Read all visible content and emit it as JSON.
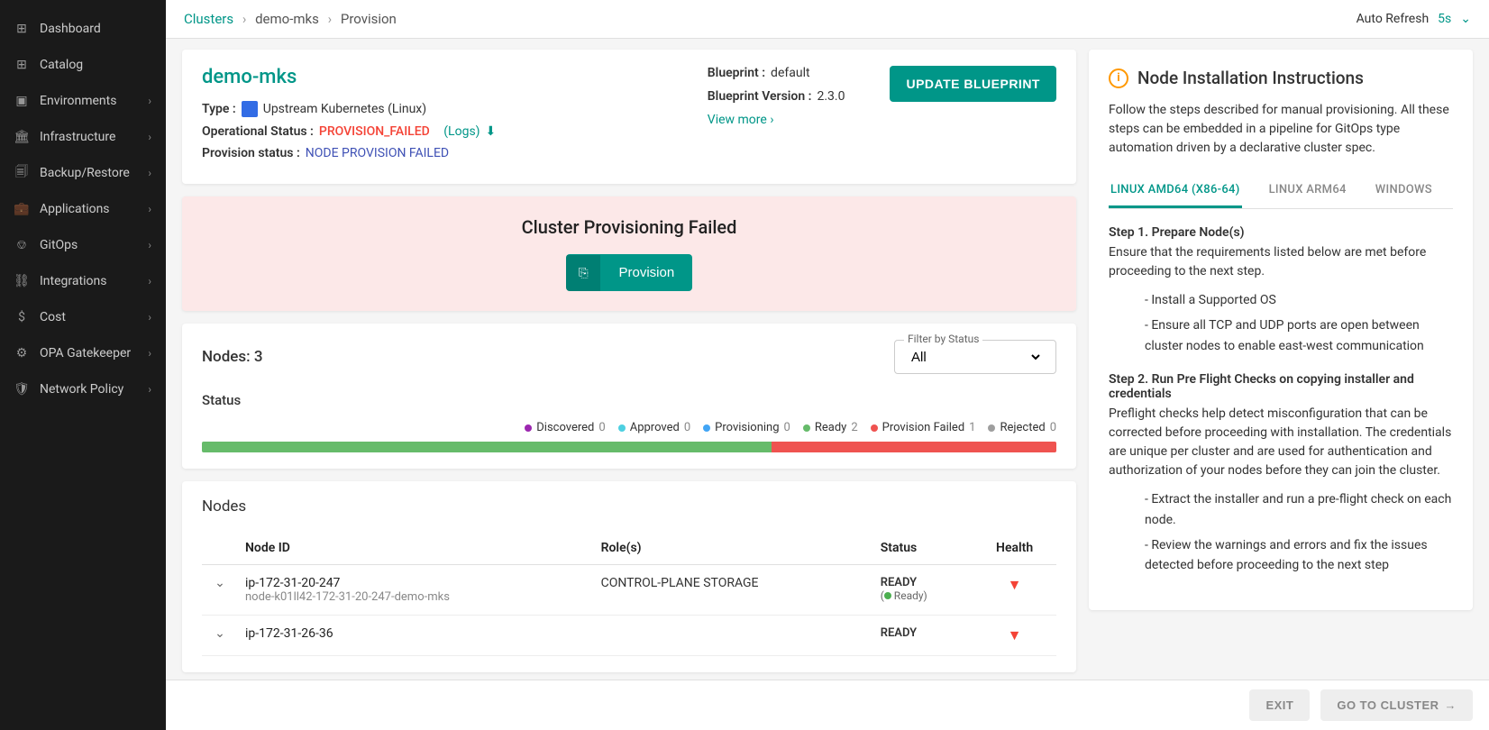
{
  "sidebar": {
    "items": [
      {
        "label": "Dashboard",
        "icon": "⊞",
        "hasChevron": false
      },
      {
        "label": "Catalog",
        "icon": "⊞",
        "hasChevron": false
      },
      {
        "label": "Environments",
        "icon": "▣",
        "hasChevron": true
      },
      {
        "label": "Infrastructure",
        "icon": "🏛",
        "hasChevron": true
      },
      {
        "label": "Backup/Restore",
        "icon": "🗐",
        "hasChevron": true
      },
      {
        "label": "Applications",
        "icon": "💼",
        "hasChevron": true
      },
      {
        "label": "GitOps",
        "icon": "⎊",
        "hasChevron": true
      },
      {
        "label": "Integrations",
        "icon": "⛓",
        "hasChevron": true
      },
      {
        "label": "Cost",
        "icon": "$",
        "hasChevron": true
      },
      {
        "label": "OPA Gatekeeper",
        "icon": "⚙",
        "hasChevron": true
      },
      {
        "label": "Network Policy",
        "icon": "🛡",
        "hasChevron": true
      }
    ]
  },
  "breadcrumb": {
    "root": "Clusters",
    "mid": "demo-mks",
    "leaf": "Provision"
  },
  "autoRefresh": {
    "label": "Auto Refresh",
    "value": "5s"
  },
  "cluster": {
    "name": "demo-mks",
    "typeLabel": "Type :",
    "typeValue": "Upstream Kubernetes (Linux)",
    "opStatusLabel": "Operational Status :",
    "opStatusValue": "PROVISION_FAILED",
    "logsLink": "(Logs)",
    "provStatusLabel": "Provision status :",
    "provStatusValue": "NODE PROVISION FAILED",
    "blueprintLabel": "Blueprint :",
    "blueprintValue": "default",
    "blueprintVersionLabel": "Blueprint Version :",
    "blueprintVersionValue": "2.3.0",
    "viewMore": "View more",
    "updateBtn": "UPDATE BLUEPRINT"
  },
  "failBanner": {
    "title": "Cluster Provisioning Failed",
    "button": "Provision"
  },
  "nodesPanel": {
    "countLabel": "Nodes: 3",
    "filterLabel": "Filter by Status",
    "filterValue": "All",
    "statusHeading": "Status",
    "legend": [
      {
        "label": "Discovered",
        "count": "0",
        "color": "#9c27b0"
      },
      {
        "label": "Approved",
        "count": "0",
        "color": "#4dd0e1"
      },
      {
        "label": "Provisioning",
        "count": "0",
        "color": "#42a5f5"
      },
      {
        "label": "Ready",
        "count": "2",
        "color": "#66bb6a"
      },
      {
        "label": "Provision Failed",
        "count": "1",
        "color": "#ef5350"
      },
      {
        "label": "Rejected",
        "count": "0",
        "color": "#9e9e9e"
      }
    ]
  },
  "chart_data": {
    "type": "bar",
    "title": "Status",
    "categories": [
      "Discovered",
      "Approved",
      "Provisioning",
      "Ready",
      "Provision Failed",
      "Rejected"
    ],
    "values": [
      0,
      0,
      0,
      2,
      1,
      0
    ],
    "series": [
      {
        "name": "Discovered",
        "value": 0,
        "color": "#9c27b0"
      },
      {
        "name": "Approved",
        "value": 0,
        "color": "#4dd0e1"
      },
      {
        "name": "Provisioning",
        "value": 0,
        "color": "#42a5f5"
      },
      {
        "name": "Ready",
        "value": 2,
        "color": "#66bb6a"
      },
      {
        "name": "Provision Failed",
        "value": 1,
        "color": "#ef5350"
      },
      {
        "name": "Rejected",
        "value": 0,
        "color": "#9e9e9e"
      }
    ],
    "total": 3
  },
  "nodesTable": {
    "title": "Nodes",
    "headers": {
      "nodeId": "Node ID",
      "roles": "Role(s)",
      "status": "Status",
      "health": "Health"
    },
    "rows": [
      {
        "id": "ip-172-31-20-247",
        "sub": "node-k01ll42-172-31-20-247-demo-mks",
        "roles": "CONTROL-PLANE STORAGE",
        "status": "READY",
        "statusSub": "Ready"
      },
      {
        "id": "ip-172-31-26-36",
        "sub": "",
        "roles": "",
        "status": "READY",
        "statusSub": ""
      }
    ]
  },
  "instructions": {
    "title": "Node Installation Instructions",
    "desc": "Follow the steps described for manual provisioning. All these steps can be embedded in a pipeline for GitOps type automation driven by a declarative cluster spec.",
    "tabs": [
      "LINUX AMD64 (X86-64)",
      "LINUX ARM64",
      "WINDOWS"
    ],
    "step1Title": "Step 1. Prepare Node(s)",
    "step1Desc": "Ensure that the requirements listed below are met before proceeding to the next step.",
    "step1Items": [
      "- Install a Supported OS",
      "- Ensure all TCP and UDP ports are open between cluster nodes to enable east-west communication"
    ],
    "step2Title": "Step 2. Run Pre Flight Checks on copying installer and credentials",
    "step2Desc": "Preflight checks help detect misconfiguration that can be corrected before proceeding with installation. The credentials are unique per cluster and are used for authentication and authorization of your nodes before they can join the cluster.",
    "step2Items": [
      "- Extract the installer and run a pre-flight check on each node.",
      "- Review the warnings and errors and fix the issues detected before proceeding to the next step"
    ]
  },
  "footer": {
    "exit": "EXIT",
    "goto": "GO TO CLUSTER"
  }
}
